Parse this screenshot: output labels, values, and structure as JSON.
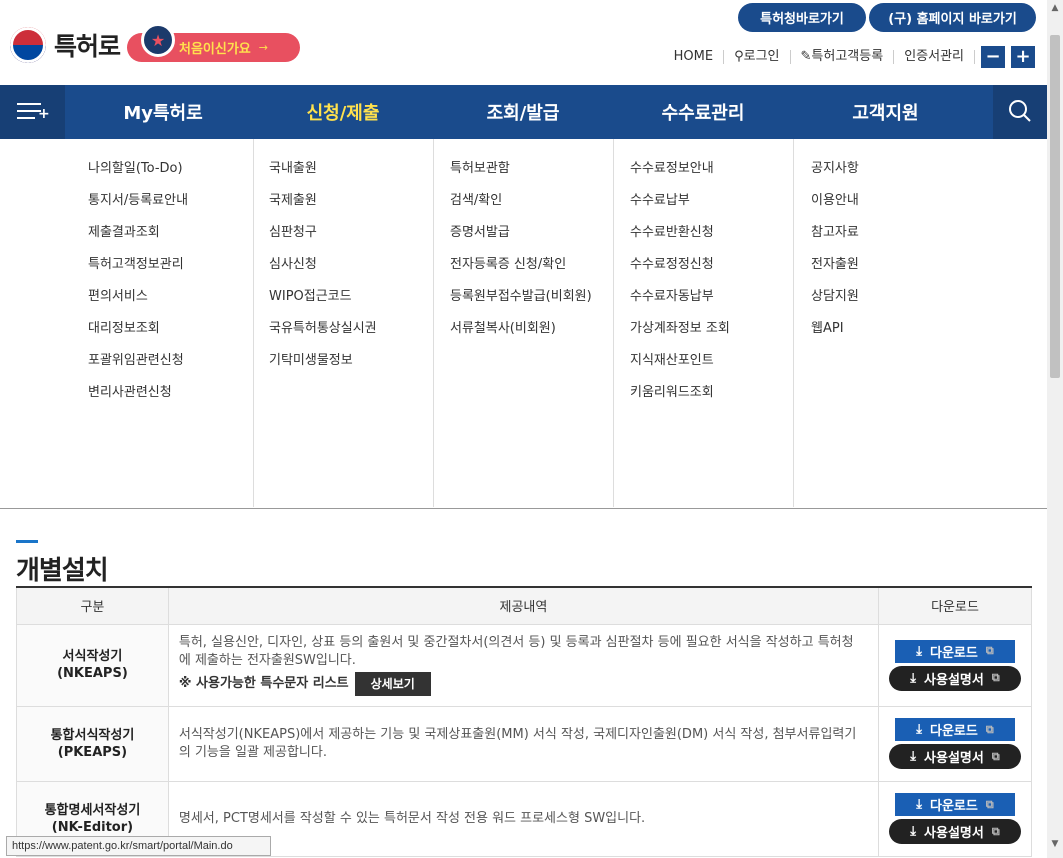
{
  "header": {
    "logo_text": "특허로",
    "first_visit": "처음이신가요",
    "top_buttons": [
      "특허청바로가기",
      "(구) 홈페이지 바로가기"
    ],
    "util": [
      "HOME",
      "로그인",
      "특허고객등록",
      "인증서관리"
    ],
    "zoom_out": "−",
    "zoom_in": "+"
  },
  "gnb": {
    "items": [
      "My특허로",
      "신청/제출",
      "조회/발급",
      "수수료관리",
      "고객지원"
    ],
    "active_index": 1
  },
  "mega": {
    "columns": [
      [
        "나의할일(To-Do)",
        "통지서/등록료안내",
        "제출결과조회",
        "특허고객정보관리",
        "편의서비스",
        "대리정보조회",
        "포괄위임관련신청",
        "변리사관련신청"
      ],
      [
        "국내출원",
        "국제출원",
        "심판청구",
        "심사신청",
        "WIPO접근코드",
        "국유특허통상실시권",
        "기탁미생물정보"
      ],
      [
        "특허보관함",
        "검색/확인",
        "증명서발급",
        "전자등록증 신청/확인",
        "등록원부접수발급(비회원)",
        "서류철복사(비회원)"
      ],
      [
        "수수료정보안내",
        "수수료납부",
        "수수료반환신청",
        "수수료정정신청",
        "수수료자동납부",
        "가상계좌정보 조회",
        "지식재산포인트",
        "키움리워드조회"
      ],
      [
        "공지사항",
        "이용안내",
        "참고자료",
        "전자출원",
        "상담지원",
        "웹API"
      ]
    ]
  },
  "section": {
    "title": "개별설치",
    "table": {
      "headers": [
        "구분",
        "제공내역",
        "다운로드"
      ],
      "rows": [
        {
          "name_line1": "서식작성기",
          "name_line2": "(NKEAPS)",
          "desc": "특허, 실용신안, 디자인, 상표 등의 출원서 및 중간절차서(의견서 등) 및 등록과 심판절차 등에 필요한 서식을 작성하고 특허청에 제출하는 전자출원SW입니다.",
          "note": "※ 사용가능한 특수문자 리스트",
          "detail": "상세보기"
        },
        {
          "name_line1": "통합서식작성기",
          "name_line2": "(PKEAPS)",
          "desc": "서식작성기(NKEAPS)에서 제공하는 기능 및 국제상표출원(MM) 서식 작성, 국제디자인출원(DM) 서식 작성, 첨부서류입력기의 기능을 일괄 제공합니다."
        },
        {
          "name_line1": "통합명세서작성기",
          "name_line2": "(NK-Editor)",
          "desc": "명세서, PCT명세서를 작성할 수 있는 특허문서 작성 전용 워드 프로세스형 SW입니다."
        }
      ],
      "download_label": "다운로드",
      "manual_label": "사용설명서"
    }
  },
  "status_url": "https://www.patent.go.kr/smart/portal/Main.do",
  "colors": {
    "primary": "#1a4b8c",
    "active_menu": "#ffe14d",
    "first_visit_bg": "#e85060",
    "download_btn": "#1a5fb4"
  }
}
